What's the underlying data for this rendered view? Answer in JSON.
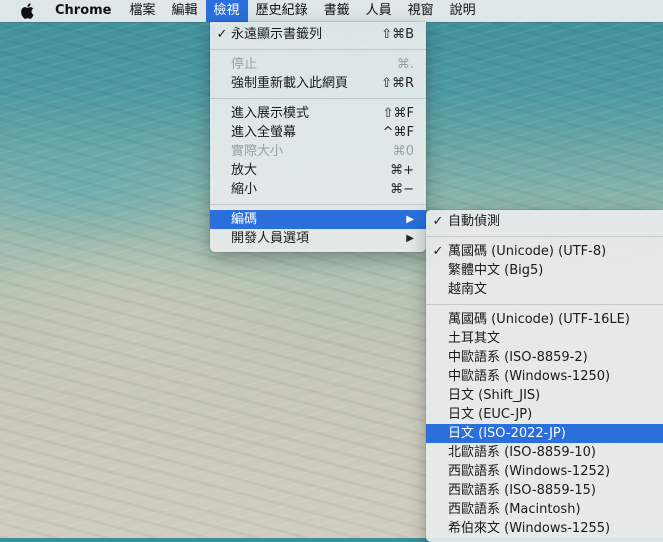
{
  "menubar": {
    "apple_icon": "apple-logo-icon",
    "items": [
      "Chrome",
      "檔案",
      "編輯",
      "檢視",
      "歷史紀錄",
      "書籤",
      "人員",
      "視窗",
      "說明"
    ],
    "active_index": 3
  },
  "view_menu": {
    "always_show_bookmarks": {
      "label": "永遠顯示書籤列",
      "shortcut": "⇧⌘B",
      "checked": true
    },
    "stop": {
      "label": "停止",
      "shortcut": "⌘.",
      "disabled": true
    },
    "force_reload": {
      "label": "強制重新載入此網頁",
      "shortcut": "⇧⌘R"
    },
    "presentation_mode": {
      "label": "進入展示模式",
      "shortcut": "⇧⌘F"
    },
    "full_screen": {
      "label": "進入全螢幕",
      "shortcut": "^⌘F"
    },
    "actual_size": {
      "label": "實際大小",
      "shortcut": "⌘0",
      "disabled": true
    },
    "zoom_in": {
      "label": "放大",
      "shortcut": "⌘+"
    },
    "zoom_out": {
      "label": "縮小",
      "shortcut": "⌘−"
    },
    "encoding": {
      "label": "編碼",
      "highlighted": true
    },
    "developer": {
      "label": "開發人員選項"
    }
  },
  "encoding_menu": {
    "auto_detect": {
      "label": "自動偵測",
      "checked": true
    },
    "group1": [
      {
        "label": "萬國碼 (Unicode) (UTF-8)",
        "checked": true
      },
      {
        "label": "繁體中文 (Big5)"
      },
      {
        "label": "越南文"
      }
    ],
    "group2": [
      {
        "label": "萬國碼 (Unicode) (UTF-16LE)"
      },
      {
        "label": "土耳其文"
      },
      {
        "label": "中歐語系 (ISO-8859-2)"
      },
      {
        "label": "中歐語系 (Windows-1250)"
      },
      {
        "label": "日文 (Shift_JIS)"
      },
      {
        "label": "日文 (EUC-JP)"
      },
      {
        "label": "日文 (ISO-2022-JP)",
        "highlighted": true
      },
      {
        "label": "北歐語系 (ISO-8859-10)"
      },
      {
        "label": "西歐語系 (Windows-1252)"
      },
      {
        "label": "西歐語系 (ISO-8859-15)"
      },
      {
        "label": "西歐語系 (Macintosh)"
      },
      {
        "label": "希伯來文 (Windows-1255)"
      }
    ]
  },
  "glyphs": {
    "check": "✓",
    "submenu_arrow": "▶"
  },
  "colors": {
    "highlight": "#2a6fdb",
    "menubar_bg": "#eceeee"
  }
}
